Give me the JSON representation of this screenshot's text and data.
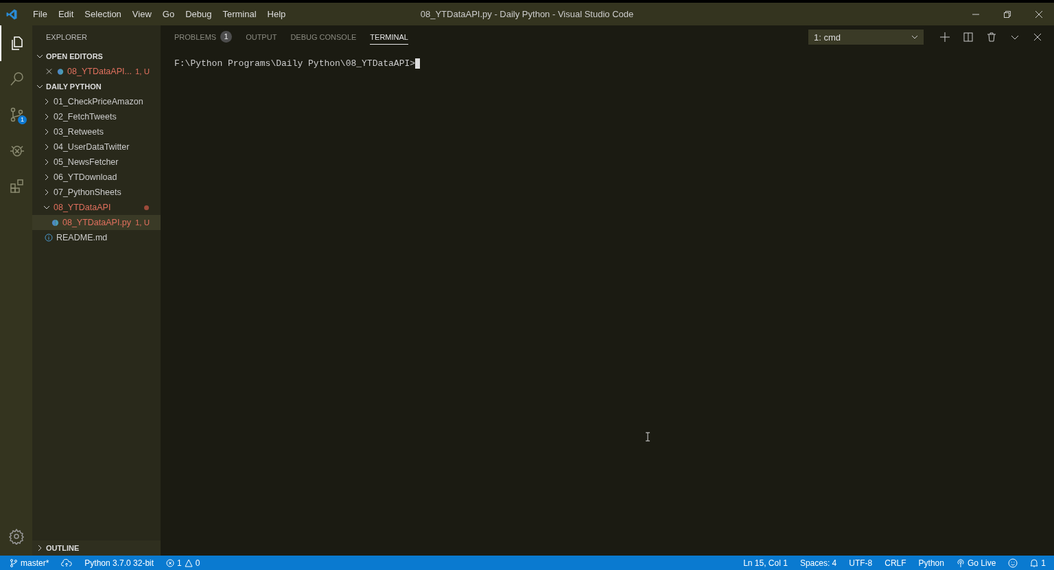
{
  "window": {
    "title": "08_YTDataAPI.py - Daily Python - Visual Studio Code"
  },
  "menu": [
    "File",
    "Edit",
    "Selection",
    "View",
    "Go",
    "Debug",
    "Terminal",
    "Help"
  ],
  "activity_bar": [
    {
      "kind": "files",
      "selected": true
    },
    {
      "kind": "search",
      "selected": false
    },
    {
      "kind": "scm",
      "selected": false,
      "badge": "1"
    },
    {
      "kind": "debug",
      "selected": false
    },
    {
      "kind": "extensions",
      "selected": false
    }
  ],
  "sidebar": {
    "title": "EXPLORER",
    "open_editors": {
      "title": "OPEN EDITORS",
      "expanded": true,
      "items": [
        {
          "name": "08_YTDataAPI...",
          "badge": "1, U",
          "modified": true
        }
      ]
    },
    "folder": {
      "title": "DAILY PYTHON",
      "expanded": true,
      "children": [
        {
          "kind": "folder",
          "name": "01_CheckPriceAmazon",
          "expanded": false,
          "modified": false,
          "selected": false
        },
        {
          "kind": "folder",
          "name": "02_FetchTweets",
          "expanded": false,
          "modified": false,
          "selected": false
        },
        {
          "kind": "folder",
          "name": "03_Retweets",
          "expanded": false,
          "modified": false,
          "selected": false
        },
        {
          "kind": "folder",
          "name": "04_UserDataTwitter",
          "expanded": false,
          "modified": false,
          "selected": false
        },
        {
          "kind": "folder",
          "name": "05_NewsFetcher",
          "expanded": false,
          "modified": false,
          "selected": false
        },
        {
          "kind": "folder",
          "name": "06_YTDownload",
          "expanded": false,
          "modified": false,
          "selected": false
        },
        {
          "kind": "folder",
          "name": "07_PythonSheets",
          "expanded": false,
          "modified": false,
          "selected": false
        },
        {
          "kind": "folder",
          "name": "08_YTDataAPI",
          "expanded": true,
          "modified": true,
          "selected": false,
          "children": [
            {
              "kind": "python",
              "name": "08_YTDataAPI.py",
              "badge": "1, U",
              "modified": true,
              "selected": true
            }
          ]
        },
        {
          "kind": "info",
          "name": "README.md",
          "modified": false,
          "selected": false
        }
      ]
    },
    "outline": {
      "title": "OUTLINE",
      "expanded": false
    }
  },
  "panel": {
    "tabs": [
      {
        "label": "PROBLEMS",
        "badge": "1",
        "selected": false
      },
      {
        "label": "OUTPUT",
        "selected": false
      },
      {
        "label": "DEBUG CONSOLE",
        "selected": false
      },
      {
        "label": "TERMINAL",
        "selected": true
      }
    ],
    "terminal_select": "1: cmd",
    "terminal_lines": [
      "F:\\Python Programs\\Daily Python\\08_YTDataAPI>"
    ]
  },
  "status_bar": {
    "branch": "master*",
    "interpreter": "Python 3.7.0 32-bit",
    "errors": "1",
    "warnings": "0",
    "right": [
      {
        "kind": "text",
        "label": "Ln 15, Col 1"
      },
      {
        "kind": "text",
        "label": "Spaces: 4"
      },
      {
        "kind": "text",
        "label": "UTF-8"
      },
      {
        "kind": "text",
        "label": "CRLF"
      },
      {
        "kind": "text",
        "label": "Python"
      },
      {
        "kind": "live",
        "label": "Go Live"
      },
      {
        "kind": "feedback"
      },
      {
        "kind": "bell",
        "label": "1"
      }
    ]
  }
}
